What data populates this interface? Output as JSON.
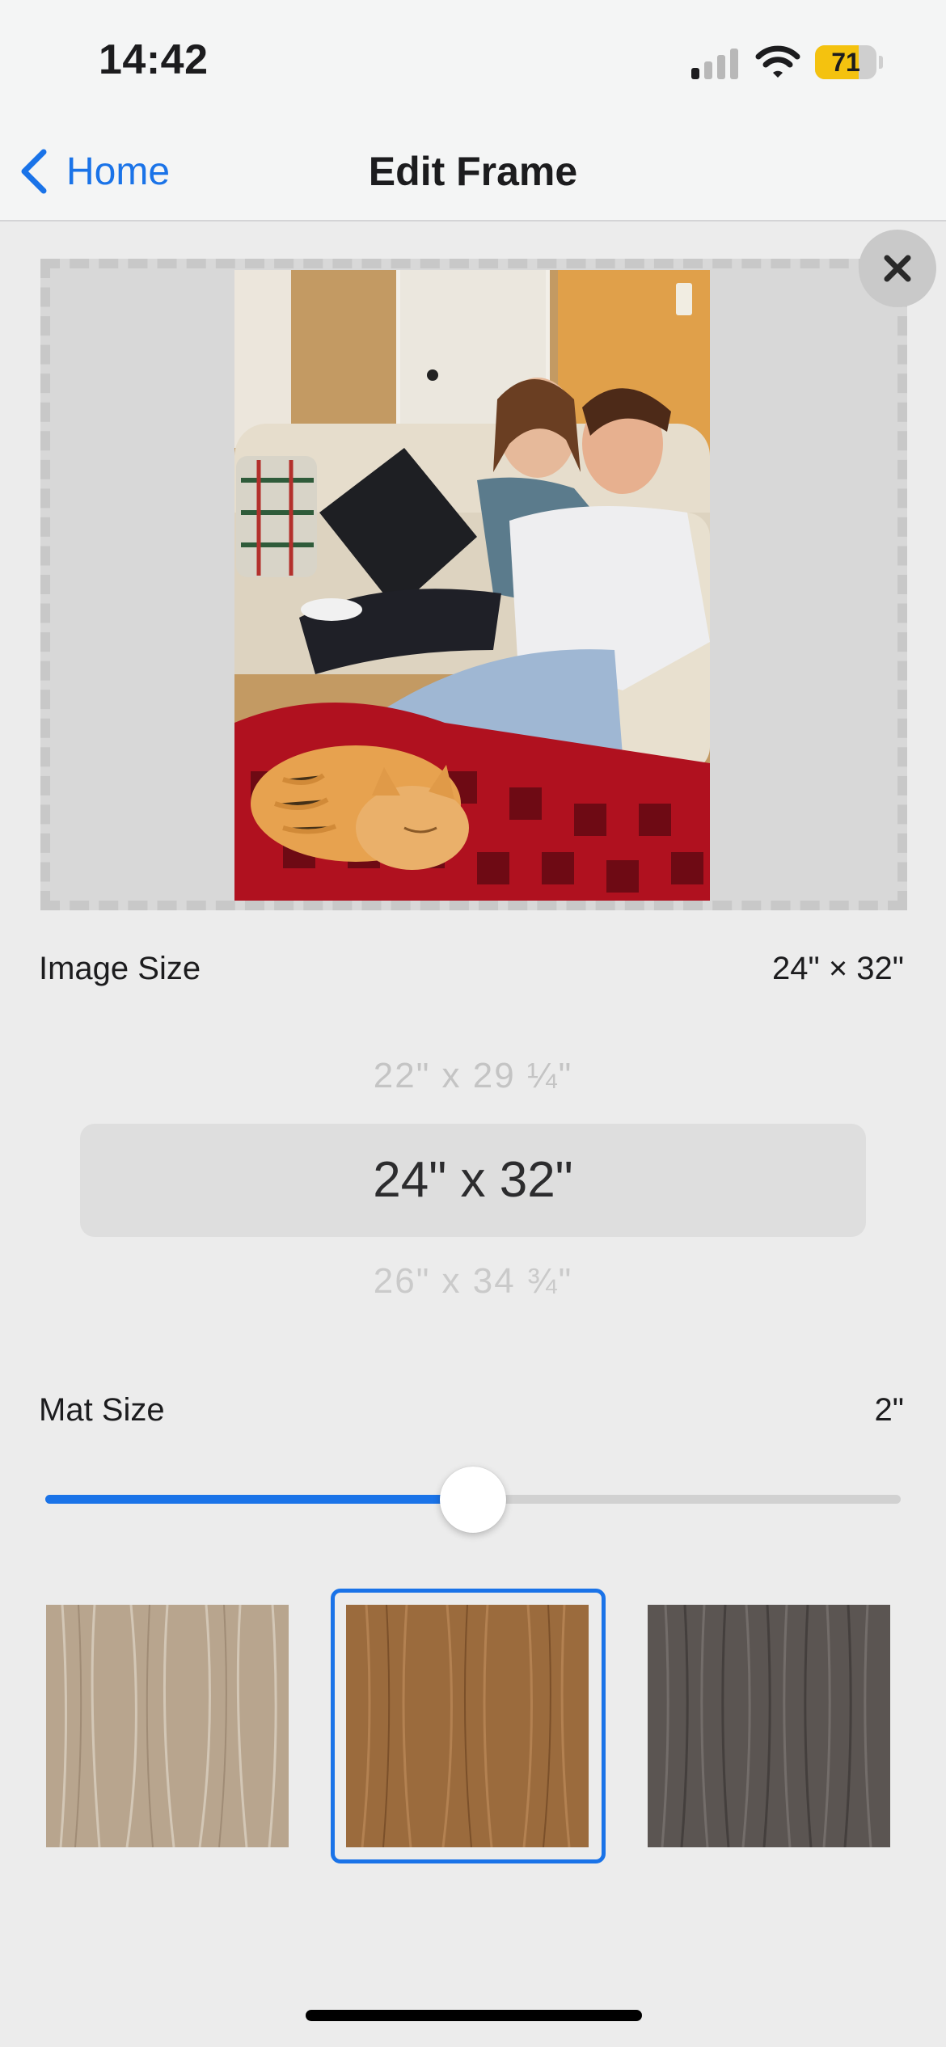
{
  "status_bar": {
    "time": "14:42",
    "battery_percent": "71",
    "battery_level": 0.71,
    "signal_bars_active": 1,
    "icons": [
      "cellular-signal-icon",
      "wifi-icon",
      "battery-icon"
    ]
  },
  "nav": {
    "back_label": "Home",
    "title": "Edit Frame"
  },
  "preview": {
    "photo_subject": "photo-preview",
    "close_icon": "close-icon"
  },
  "image_size": {
    "label": "Image Size",
    "value": "24\" × 32\"",
    "picker": {
      "previous": "22\" x 29 ¼\"",
      "selected": "24\" x 32\"",
      "next": "26\" x 34 ¾\""
    }
  },
  "mat_size": {
    "label": "Mat Size",
    "value": "2\"",
    "slider_fraction": 0.5
  },
  "frame_styles": {
    "items": [
      "light-wood",
      "medium-wood",
      "dark-wood"
    ],
    "selected": "medium-wood"
  },
  "colors": {
    "accent": "#1a73e8",
    "battery": "#f4c20f",
    "background": "#ececec"
  }
}
